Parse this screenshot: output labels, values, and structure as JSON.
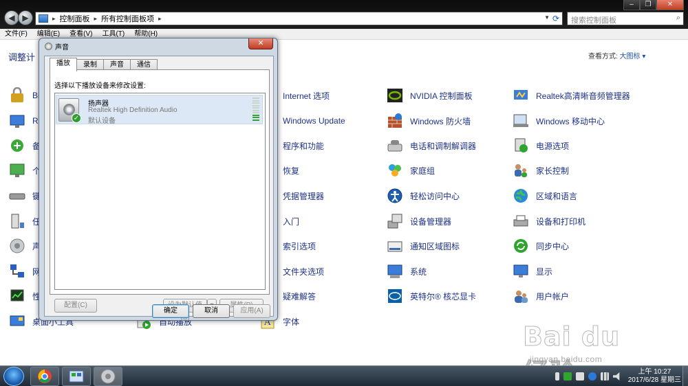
{
  "explorer": {
    "breadcrumb": [
      "控制面板",
      "所有控制面板项"
    ],
    "search_placeholder": "搜索控制面板",
    "menu": [
      "文件(F)",
      "编辑(E)",
      "查看(V)",
      "工具(T)",
      "帮助(H)"
    ],
    "adjust_text": "调整计",
    "view_by_label": "查看方式:",
    "view_by_value": "大图标"
  },
  "control_panel": {
    "col1": [
      "Bi",
      "Re",
      "备",
      "个",
      "键",
      "任",
      "声",
      "网",
      "性",
      "桌面小工具"
    ],
    "col2_partial": "自动播放",
    "col3": [
      "Internet 选项",
      "Windows Update",
      "程序和功能",
      "恢复",
      "凭据管理器",
      "入门",
      "索引选项",
      "文件夹选项",
      "疑难解答",
      "字体"
    ],
    "col4": [
      "NVIDIA 控制面板",
      "Windows 防火墙",
      "电话和调制解调器",
      "家庭组",
      "轻松访问中心",
      "设备管理器",
      "通知区域图标",
      "系统",
      "英特尔® 核芯显卡"
    ],
    "col5": [
      "Realtek高清晰音频管理器",
      "Windows 移动中心",
      "电源选项",
      "家长控制",
      "区域和语言",
      "设备和打印机",
      "同步中心",
      "显示",
      "用户帐户"
    ]
  },
  "sound_dialog": {
    "title": "声音",
    "tabs": [
      "播放",
      "录制",
      "声音",
      "通信"
    ],
    "instruction": "选择以下播放设备来修改设置:",
    "device": {
      "name": "扬声器",
      "description": "Realtek High Definition Audio",
      "status": "默认设备",
      "meter_level": 0.3
    },
    "buttons": {
      "configure": "配置(C)",
      "set_default": "设为默认值(S)",
      "properties": "属性(P)",
      "ok": "确定",
      "cancel": "取消",
      "apply": "应用(A)"
    }
  },
  "taskbar": {
    "clock_time": "上午 10:27",
    "clock_date": "2017/6/28 星期三"
  },
  "watermark": {
    "logo": "Bai du 经验",
    "url": "jingyan.baidu.com"
  }
}
